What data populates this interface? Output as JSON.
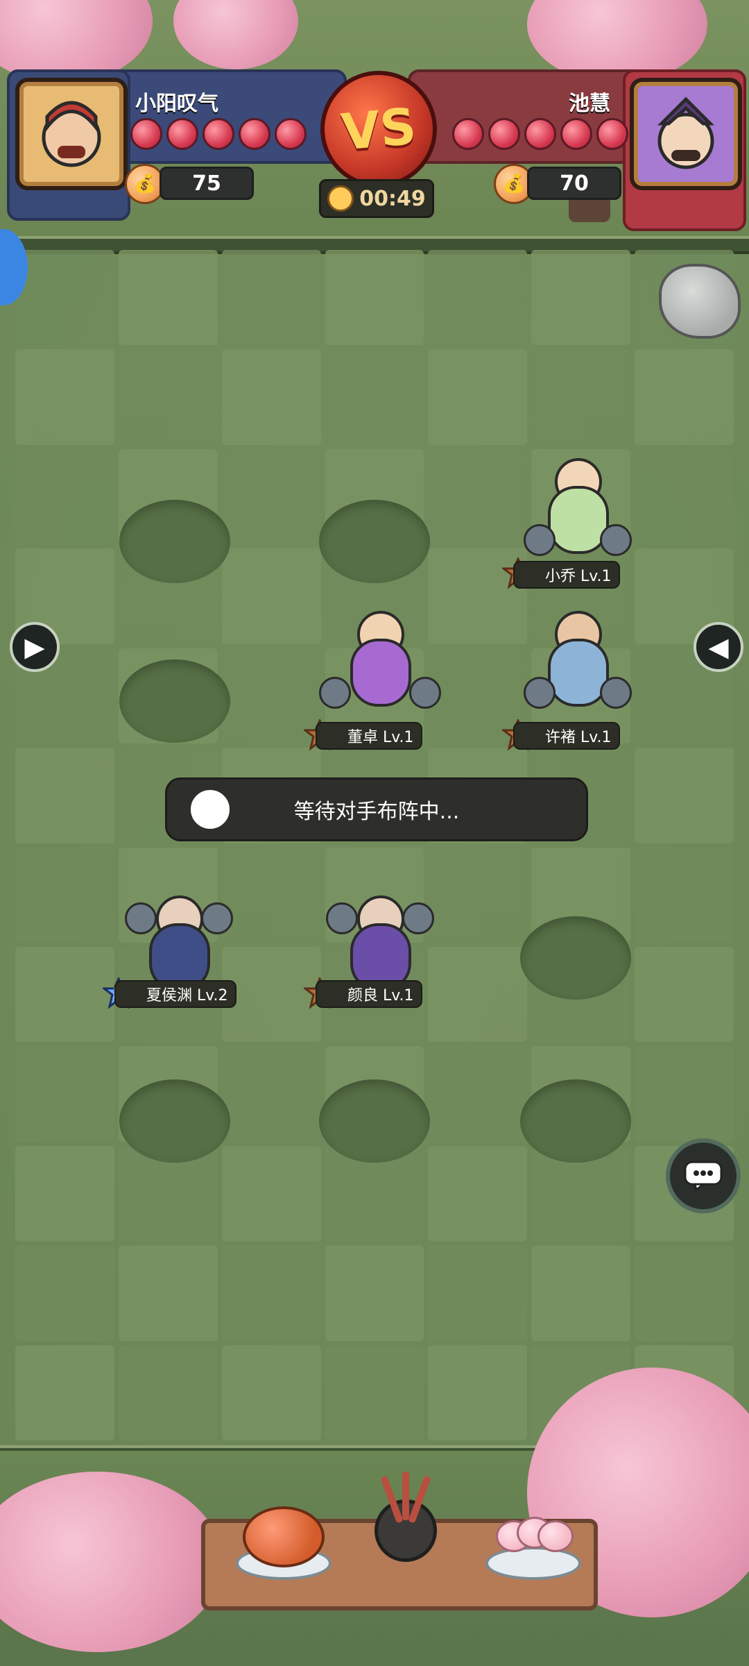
{
  "header": {
    "player_left": {
      "name": "小阳叹气",
      "hearts": 5,
      "coins": "75"
    },
    "player_right": {
      "name": "池慧",
      "hearts": 5,
      "coins": "70"
    },
    "vs_label": "VS",
    "timer": "00:49"
  },
  "board": {
    "units": [
      {
        "level_badge": "1",
        "label": "小乔 Lv.1"
      },
      {
        "level_badge": "1",
        "label": "董卓 Lv.1"
      },
      {
        "level_badge": "1",
        "label": "许褚 Lv.1"
      },
      {
        "level_badge": "2",
        "label": "夏侯渊 Lv.2"
      },
      {
        "level_badge": "1",
        "label": "颜良 Lv.1"
      }
    ],
    "status_message": "等待对手布阵中..."
  },
  "colors": {
    "grass": "#6f8a58",
    "panel_left": "#3b4a78",
    "panel_right": "#8a3b40",
    "vs_gold": "#ffd45b",
    "banner": "#2e2f2b"
  },
  "icons": {
    "left_arrow": "arrow-right-icon",
    "right_arrow": "arrow-left-icon",
    "chat": "chat-bubble-icon",
    "timer": "stopwatch-icon",
    "coin": "coin-pouch-icon"
  }
}
